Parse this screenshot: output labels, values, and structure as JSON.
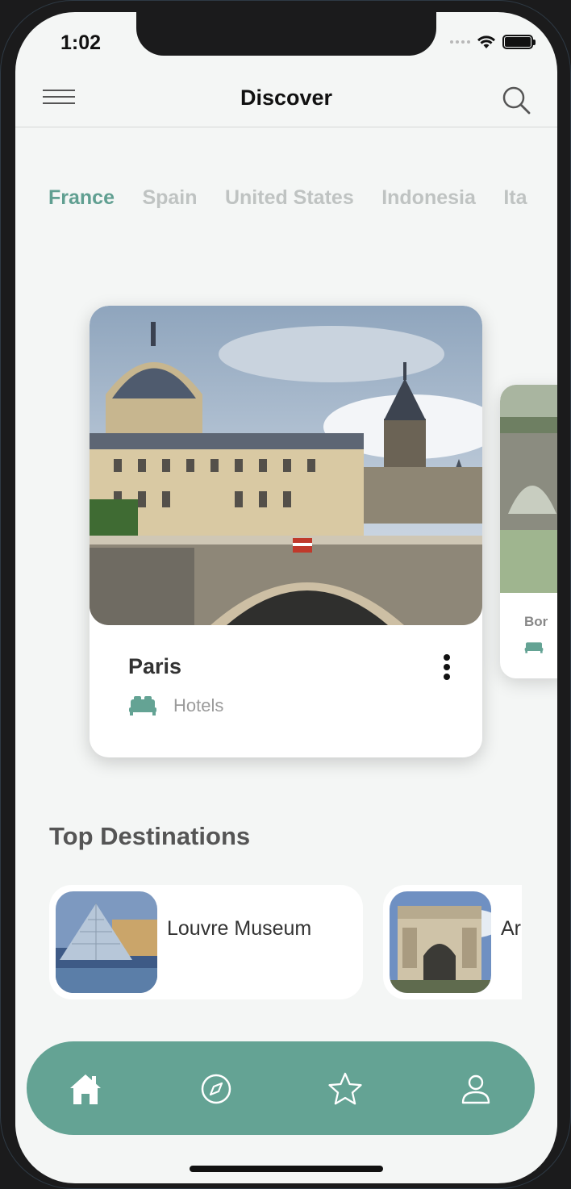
{
  "status": {
    "time": "1:02"
  },
  "appbar": {
    "title": "Discover"
  },
  "tabs": [
    {
      "label": "France",
      "active": true
    },
    {
      "label": "Spain",
      "active": false
    },
    {
      "label": "United States",
      "active": false
    },
    {
      "label": "Indonesia",
      "active": false
    },
    {
      "label": "Ita",
      "active": false
    }
  ],
  "featured": [
    {
      "name": "Paris",
      "category": "Hotels",
      "icon": "bed-icon"
    },
    {
      "name": "Bor",
      "category": "Hotels",
      "icon": "bed-icon"
    }
  ],
  "top_destinations": {
    "heading": "Top Destinations",
    "items": [
      {
        "name": "Louvre Museum"
      },
      {
        "name": "Ar"
      }
    ]
  },
  "bottom_nav": [
    "home-icon",
    "compass-icon",
    "star-icon",
    "user-icon"
  ],
  "colors": {
    "accent": "#64a394",
    "active_tab": "#609f91",
    "inactive_tab": "#bfc3c2"
  }
}
